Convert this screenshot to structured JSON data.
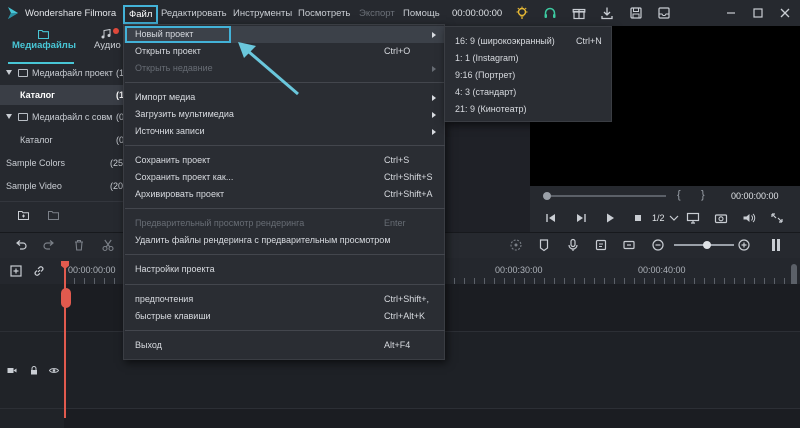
{
  "app": {
    "title": "Wondershare Filmora"
  },
  "menubar": [
    {
      "label": "Файл",
      "state": "active"
    },
    {
      "label": "Редактировать",
      "state": "normal"
    },
    {
      "label": "Инструменты",
      "state": "normal"
    },
    {
      "label": "Посмотреть",
      "state": "normal"
    },
    {
      "label": "Экспорт",
      "state": "disabled"
    },
    {
      "label": "Помощь",
      "state": "normal"
    }
  ],
  "timecode_top": "00:00:00:00",
  "colors": {
    "accent": "#48c6d6",
    "highlight_border": "#43b2d8",
    "playhead": "#e15a4e",
    "bg": "#1f2127"
  },
  "media_panel": {
    "tabs": [
      {
        "label": "Медиафайлы",
        "active": true
      },
      {
        "label": "Аудио",
        "active": false
      }
    ],
    "rows": [
      {
        "label": "Медиафайл проект",
        "count": "(1",
        "expanded": true
      },
      {
        "label": "Каталог",
        "count": "(1",
        "selected": true
      },
      {
        "label": "Медиафайл с совм",
        "count": "(0",
        "expanded": true
      },
      {
        "label": "Каталог",
        "count": "(0"
      },
      {
        "label": "Sample Colors",
        "count": "(25"
      },
      {
        "label": "Sample Video",
        "count": "(20"
      }
    ]
  },
  "file_menu": {
    "items": [
      {
        "label": "Новый проект",
        "shortcut": "",
        "submenu": true,
        "enabled": true,
        "highlight": true
      },
      {
        "label": "Открыть проект",
        "shortcut": "Ctrl+O",
        "submenu": false,
        "enabled": true
      },
      {
        "label": "Открыть недавние",
        "shortcut": "",
        "submenu": true,
        "enabled": false
      },
      {
        "label": "Импорт медиа",
        "shortcut": "",
        "submenu": true,
        "enabled": true
      },
      {
        "label": "Загрузить мультимедиа",
        "shortcut": "",
        "submenu": true,
        "enabled": true
      },
      {
        "label": "Источник записи",
        "shortcut": "",
        "submenu": true,
        "enabled": true
      },
      {
        "label": "Сохранить проект",
        "shortcut": "Ctrl+S",
        "submenu": false,
        "enabled": true
      },
      {
        "label": "Сохранить проект как...",
        "shortcut": "Ctrl+Shift+S",
        "submenu": false,
        "enabled": true
      },
      {
        "label": "Архивировать проект",
        "shortcut": "Ctrl+Shift+A",
        "submenu": false,
        "enabled": true
      },
      {
        "label": "Предварительный просмотр рендеринга",
        "shortcut": "Enter",
        "submenu": false,
        "enabled": false
      },
      {
        "label": "Удалить файлы рендеринга с предварительным просмотром",
        "shortcut": "",
        "submenu": false,
        "enabled": true
      },
      {
        "label": "Настройки проекта",
        "shortcut": "",
        "submenu": false,
        "enabled": true
      },
      {
        "label": "предпочтения",
        "shortcut": "Ctrl+Shift+,",
        "submenu": false,
        "enabled": true
      },
      {
        "label": "быстрые клавиши",
        "shortcut": "Ctrl+Alt+K",
        "submenu": false,
        "enabled": true
      },
      {
        "label": "Выход",
        "shortcut": "Alt+F4",
        "submenu": false,
        "enabled": true
      }
    ]
  },
  "new_project_submenu": {
    "items": [
      {
        "label": "16: 9 (широкоэкранный)",
        "shortcut": "Ctrl+N"
      },
      {
        "label": "1: 1 (Instagram)",
        "shortcut": ""
      },
      {
        "label": "9:16 (Портрет)",
        "shortcut": ""
      },
      {
        "label": "4: 3 (стандарт)",
        "shortcut": ""
      },
      {
        "label": "21: 9 (Кинотеатр)",
        "shortcut": ""
      }
    ]
  },
  "preview": {
    "time": "00:00:00:00",
    "ratio": "1/2",
    "brace_open": "{",
    "brace_close": "}"
  },
  "timeline": {
    "ruler": [
      "00:00:00:00",
      "00:00:30:00",
      "00:00:40:00"
    ],
    "zoom_level": 0.55
  }
}
